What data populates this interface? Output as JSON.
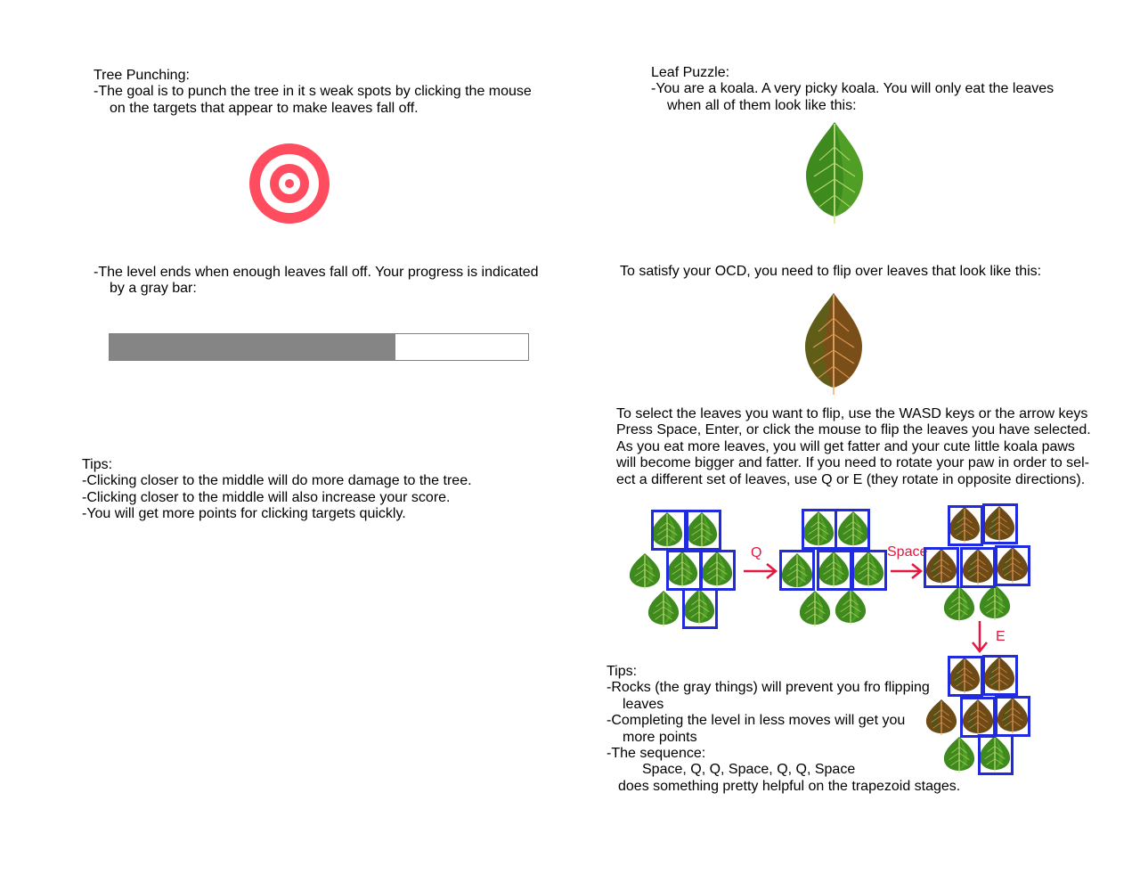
{
  "tree_punching": {
    "heading": "Tree Punching:",
    "goal_line1": "-The goal is to punch the tree in it s weak spots by clicking the mouse",
    "goal_line2": "on the targets that appear to make leaves fall off.",
    "end_line1": "-The level ends when enough leaves fall off. Your progress is indicated",
    "end_line2": "by a gray bar:",
    "progress": 0.684
  },
  "tree_tips": {
    "heading": "Tips:",
    "items": [
      "-Clicking closer to the middle will do more damage to the tree.",
      "-Clicking closer to the middle will also increase your score.",
      "-You will get more points for clicking targets quickly."
    ]
  },
  "leaf_puzzle": {
    "heading": "Leaf Puzzle:",
    "intro_line1": "-You are a koala. A very picky koala. You will only eat the leaves",
    "intro_line2": "when all of them look like this:",
    "flip_text": "To satisfy your OCD, you need to flip over leaves that look like this:",
    "controls": [
      "To select the leaves you want to flip, use the WASD keys or the arrow keys",
      "Press Space, Enter, or click the mouse to flip the leaves you have selected.",
      "As you eat more leaves, you will get fatter and your cute little koala paws",
      "will become bigger and fatter. If you need to rotate your paw in order to sel-",
      "ect a different set of leaves, use Q or E (they rotate in opposite directions)."
    ]
  },
  "diagram": {
    "label_q": "Q",
    "label_space": "Space",
    "label_e": "E",
    "colors": {
      "green_leaf": "#3f8a1f",
      "brown_leaf": "#6e4a16",
      "selection": "#1f2bdc",
      "arrow": "#e3173f"
    }
  },
  "leaf_tips": {
    "heading": "Tips:",
    "rocks_line1": "-Rocks (the gray things) will prevent you fro flipping",
    "rocks_line2": "leaves",
    "moves_line1": "-Completing the level in less moves will get you",
    "moves_line2": "more points",
    "seq_line1": "-The sequence:",
    "seq_line2": "Space, Q, Q, Space, Q, Q, Space",
    "seq_line3": "does something pretty helpful on the trapezoid stages."
  },
  "icons": {
    "target": "target-icon",
    "green_leaf": "green-leaf-icon",
    "brown_leaf": "brown-leaf-icon"
  }
}
